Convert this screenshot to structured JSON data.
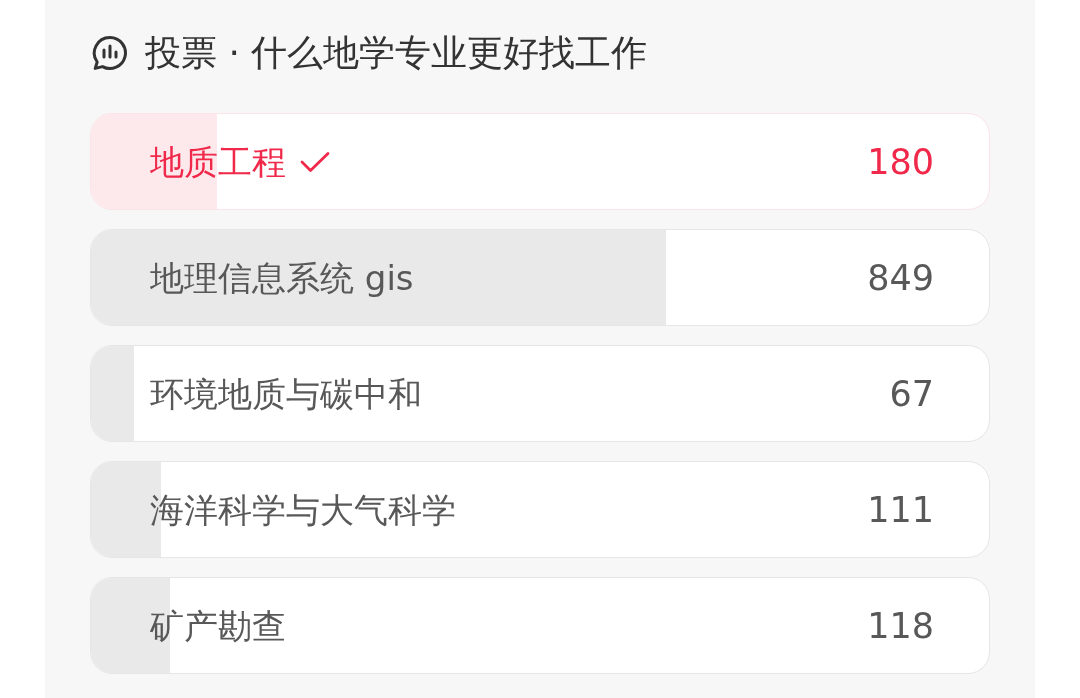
{
  "poll": {
    "title": "投票 · 什么地学专业更好找工作",
    "options": [
      {
        "label": "地质工程",
        "count": "180",
        "selected": true,
        "level": 0.14
      },
      {
        "label": "地理信息系统 gis",
        "count": "849",
        "selected": false,
        "level": 0.64
      },
      {
        "label": "环境地质与碳中和",
        "count": "67",
        "selected": false,
        "level": 0.048
      },
      {
        "label": "海洋科学与大气科学",
        "count": "111",
        "selected": false,
        "level": 0.078
      },
      {
        "label": "矿产勘查",
        "count": "118",
        "selected": false,
        "level": 0.088
      }
    ]
  }
}
